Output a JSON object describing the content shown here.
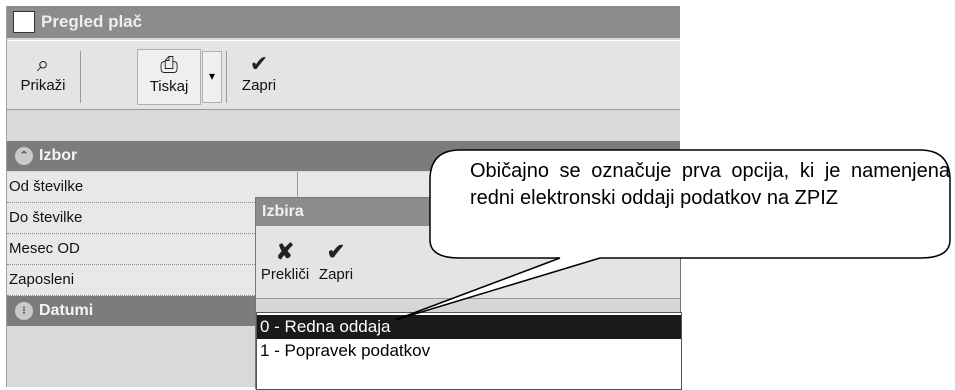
{
  "window": {
    "title": "Pregled plač"
  },
  "toolbar": {
    "show_label": "Prikaži",
    "print_label": "Tiskaj",
    "close_label": "Zapri"
  },
  "sections": {
    "izbor": "Izbor",
    "datumi": "Datumi"
  },
  "fields": [
    "Od številke",
    "Do številke",
    "Mesec OD",
    "Zaposleni"
  ],
  "dialog": {
    "title": "Izbira",
    "cancel_label": "Prekliči",
    "close_label": "Zapri",
    "options": [
      "0 - Redna oddaja",
      "1 - Popravek podatkov"
    ],
    "selected": "0 - Redna oddaja"
  },
  "callout": {
    "text": "Običajno se označuje prva opcija, ki je namenjena redni elektronski oddaji podatkov na ZPIZ"
  }
}
